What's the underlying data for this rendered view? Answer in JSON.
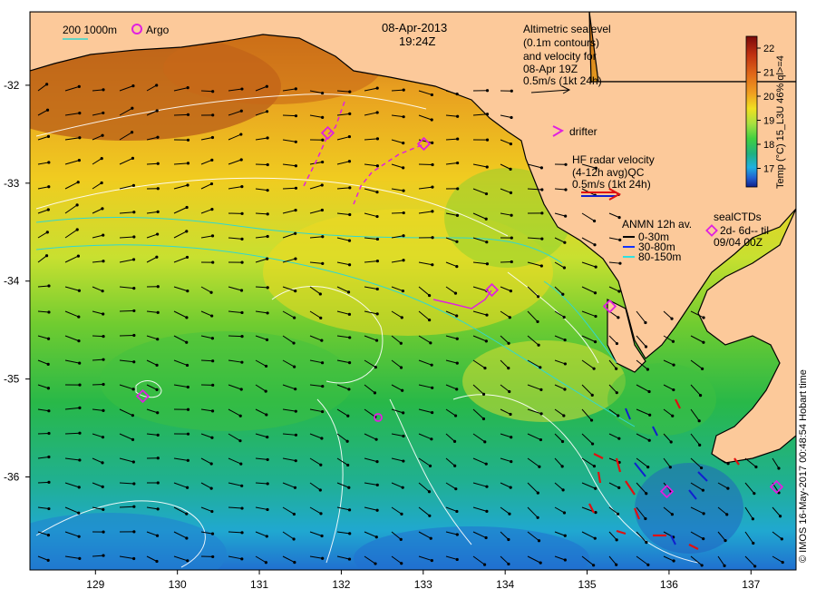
{
  "map": {
    "date": "08-Apr-2013",
    "time": "19:24Z",
    "lon_ticks": [
      "129",
      "130",
      "131",
      "132",
      "133",
      "134",
      "135",
      "136",
      "137"
    ],
    "lat_ticks": [
      "-32",
      "-33",
      "-34",
      "-35",
      "-36"
    ],
    "lon_range": [
      128.2,
      137.55
    ],
    "lat_range": [
      -36.95,
      -31.25
    ]
  },
  "legend": {
    "bathymetry": "200 1000m",
    "argo": "Argo",
    "altimetric": [
      "Altimetric sealevel",
      "(0.1m contours)",
      "and velocity for",
      "08-Apr 19Z",
      "0.5m/s (1kt 24h)"
    ],
    "drifter": "drifter",
    "hf_radar": [
      "HF radar velocity",
      "(4-12h avg)QC",
      "0.5m/s (1kt 24h)"
    ],
    "anmn": {
      "title": "ANMN 12h av.",
      "items": [
        {
          "label": "0-30m",
          "color": "#000000"
        },
        {
          "label": "30-80m",
          "color": "#1030ff"
        },
        {
          "label": "80-150m",
          "color": "#30e0e0"
        }
      ]
    },
    "sealctds": [
      "sealCTDs",
      "2d- 6d-- til",
      "09/04 00Z"
    ]
  },
  "colorbar": {
    "ticks": [
      "22",
      "21",
      "20",
      "19",
      "18",
      "17"
    ],
    "label": "Temp (°C) 15_L3U 46% ql>=4",
    "colors": [
      "#7a0a0a",
      "#c03010",
      "#e06818",
      "#f0a020",
      "#f0e020",
      "#a8e040",
      "#40d040",
      "#20b080",
      "#20b0e0",
      "#2060d0",
      "#10208a"
    ]
  },
  "credit": "© IMOS 16-May-2017 00:48:54 Hobart time",
  "colors": {
    "land": "#fcc99a",
    "magenta": "#e020e0"
  }
}
